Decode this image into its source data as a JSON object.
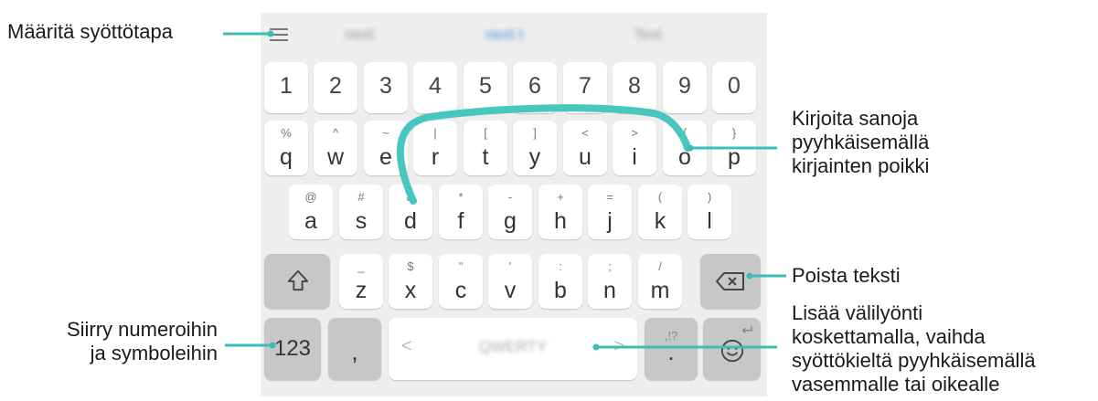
{
  "annotations": {
    "input_method": "Määritä syöttötapa",
    "swipe_words": [
      "Kirjoita sanoja",
      "pyyhkäisemällä",
      "kirjainten poikki"
    ],
    "delete_text": "Poista teksti",
    "space_action": [
      "Lisää välilyönti",
      "koskettamalla, vaihda",
      "syöttökieltä pyyhkäisemällä",
      "vasemmalle tai oikealle"
    ],
    "numbers_symbols": [
      "Siirry numeroihin",
      "ja symboleihin"
    ]
  },
  "suggestions": [
    "next",
    "next t",
    "Text"
  ],
  "keyboard": {
    "number_row": [
      "1",
      "2",
      "3",
      "4",
      "5",
      "6",
      "7",
      "8",
      "9",
      "0"
    ],
    "row_qwerty": [
      {
        "key": "q",
        "alt": "%"
      },
      {
        "key": "w",
        "alt": "^"
      },
      {
        "key": "e",
        "alt": "~"
      },
      {
        "key": "r",
        "alt": "|"
      },
      {
        "key": "t",
        "alt": "["
      },
      {
        "key": "y",
        "alt": "]"
      },
      {
        "key": "u",
        "alt": "<"
      },
      {
        "key": "i",
        "alt": ">"
      },
      {
        "key": "o",
        "alt": "{"
      },
      {
        "key": "p",
        "alt": "}"
      }
    ],
    "row_asdf": [
      {
        "key": "a",
        "alt": "@"
      },
      {
        "key": "s",
        "alt": "#"
      },
      {
        "key": "d",
        "alt": "&"
      },
      {
        "key": "f",
        "alt": "*"
      },
      {
        "key": "g",
        "alt": "-"
      },
      {
        "key": "h",
        "alt": "+"
      },
      {
        "key": "j",
        "alt": "="
      },
      {
        "key": "k",
        "alt": "("
      },
      {
        "key": "l",
        "alt": ")"
      }
    ],
    "row_zxcv": [
      {
        "key": "z",
        "alt": "_"
      },
      {
        "key": "x",
        "alt": "$"
      },
      {
        "key": "c",
        "alt": "\""
      },
      {
        "key": "v",
        "alt": "'"
      },
      {
        "key": "b",
        "alt": ":"
      },
      {
        "key": "n",
        "alt": ";"
      },
      {
        "key": "m",
        "alt": "/"
      }
    ],
    "symbols_key": "123",
    "comma_key": ",",
    "space_label": "QWERTY",
    "space_left_arrow": "<",
    "space_right_arrow": ">",
    "period_key": ".",
    "period_alt": ",!?",
    "shift_icon": "shift-icon",
    "backspace_icon": "backspace-icon",
    "emoji_icon": "smiley-icon"
  },
  "colors": {
    "accent": "#3dbdb5",
    "trace": "#48c6c0"
  }
}
